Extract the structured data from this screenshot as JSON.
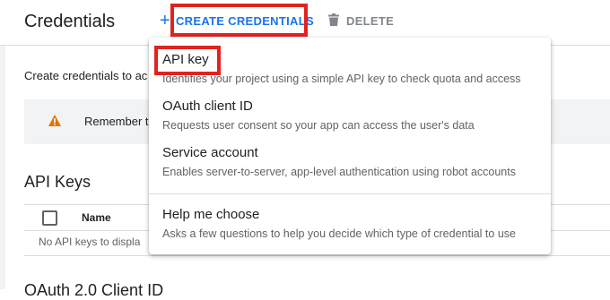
{
  "header": {
    "title": "Credentials",
    "create_label": "CREATE CREDENTIALS",
    "delete_label": "DELETE",
    "plus_glyph": "+"
  },
  "main": {
    "intro": "Create credentials to ac",
    "notice_text": "Remember t",
    "api_keys_title": "API Keys",
    "table_column_name": "Name",
    "empty_text": "No API keys to displa",
    "oauth_title_partial": "OAuth 2.0 Client ID"
  },
  "menu": {
    "items": [
      {
        "title": "API key",
        "description": "Identifies your project using a simple API key to check quota and access"
      },
      {
        "title": "OAuth client ID",
        "description": "Requests user consent so your app can access the user's data"
      },
      {
        "title": "Service account",
        "description": "Enables server-to-server, app-level authentication using robot accounts"
      },
      {
        "title": "Help me choose",
        "description": "Asks a few questions to help you decide which type of credential to use"
      }
    ]
  },
  "colors": {
    "accent": "#1a73e8",
    "highlight": "#e0231f",
    "warning": "#e37400"
  },
  "icons": {
    "create": "plus-icon",
    "delete": "trash-icon",
    "notice": "warning-icon"
  }
}
